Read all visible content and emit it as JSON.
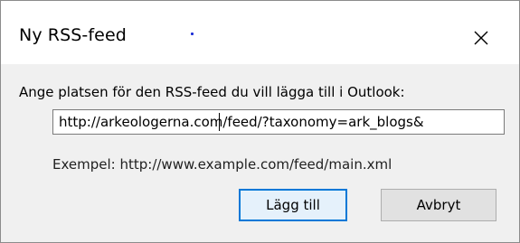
{
  "dialog": {
    "title": "Ny RSS-feed",
    "prompt": "Ange platsen för den RSS-feed du vill lägga till i Outlook:",
    "url_value": "http://arkeologerna.com/feed/?taxonomy=ark_blogs&",
    "example": "Exempel: http://www.example.com/feed/main.xml",
    "add_label": "Lägg till",
    "cancel_label": "Avbryt"
  },
  "icons": {
    "close": "close-icon"
  },
  "colors": {
    "accent": "#0078d7",
    "dialog_bg": "#f0f0f0",
    "title_bg": "#ffffff",
    "button_bg": "#e1e1e1",
    "default_button_bg": "#e5f1fb"
  }
}
